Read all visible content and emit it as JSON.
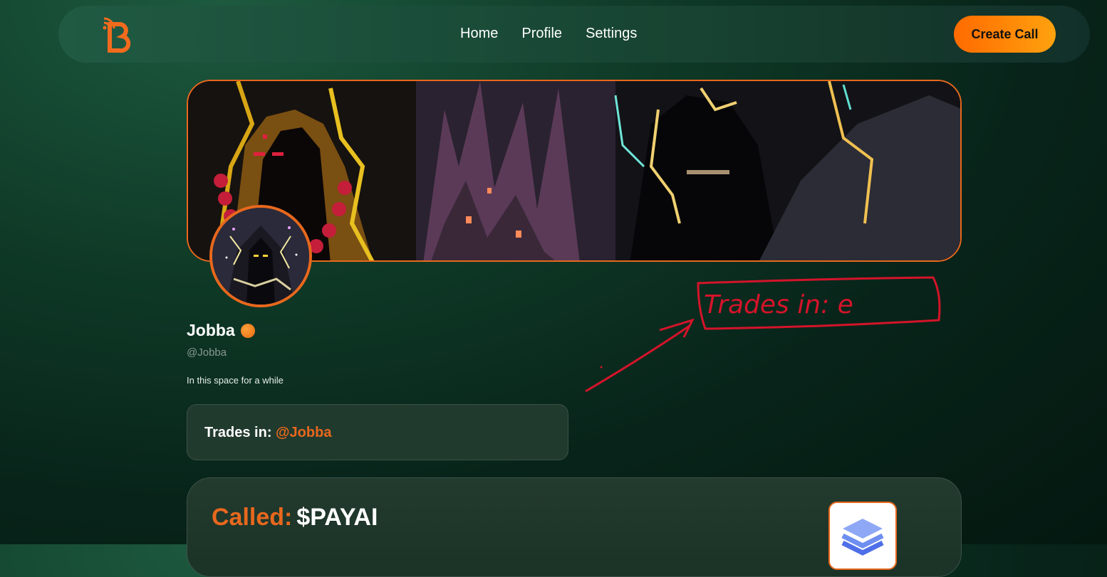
{
  "nav": {
    "links": [
      "Home",
      "Profile",
      "Settings"
    ],
    "create_label": "Create Call"
  },
  "profile": {
    "name": "Jobba",
    "handle": "@Jobba",
    "bio": "In this space for a while",
    "trades_label": "Trades in:",
    "trades_handle": "@Jobba"
  },
  "call": {
    "label": "Called:",
    "ticker": "$PAYAI"
  },
  "annotation": {
    "text": "Trades in: e"
  },
  "colors": {
    "accent": "#e8681d",
    "button_start": "#ff6a00",
    "button_end": "#ffa20e",
    "background": "#0f3a27",
    "annotation_red": "#d4142a"
  }
}
